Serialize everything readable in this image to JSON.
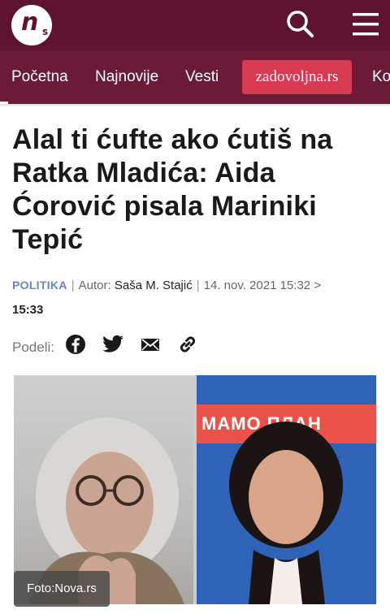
{
  "header": {
    "logo_letter": "n",
    "logo_sub": "s",
    "search_icon": "search-icon",
    "menu_icon": "hamburger-menu-icon"
  },
  "nav": {
    "items": [
      "Početna",
      "Najnovije",
      "Vesti",
      "zadovoljna.rs",
      "Ko"
    ]
  },
  "article": {
    "title": "Alal ti ćufte ako ćutiš na Ratka Mladića: Aida Ćorović pisala Mariniki Tepić",
    "category": "POLITIKA",
    "author_label": "Autor:",
    "author": "Saša M. Stajić",
    "date": "14. nov. 2021",
    "time_published": "15:32",
    "time_arrow": ">",
    "time_updated": "15:33",
    "share_label": "Podeli:",
    "share_icons": [
      "facebook-icon",
      "twitter-icon",
      "email-icon",
      "link-icon"
    ],
    "photo_banner_text": "МАМО ПЛАН",
    "photo_credit": "Foto:Nova.rs"
  },
  "colors": {
    "header_bg": "#5e1430",
    "nav_bg": "#6b1a38",
    "pill_bg": "#d83a52",
    "category": "#6a82c8"
  }
}
